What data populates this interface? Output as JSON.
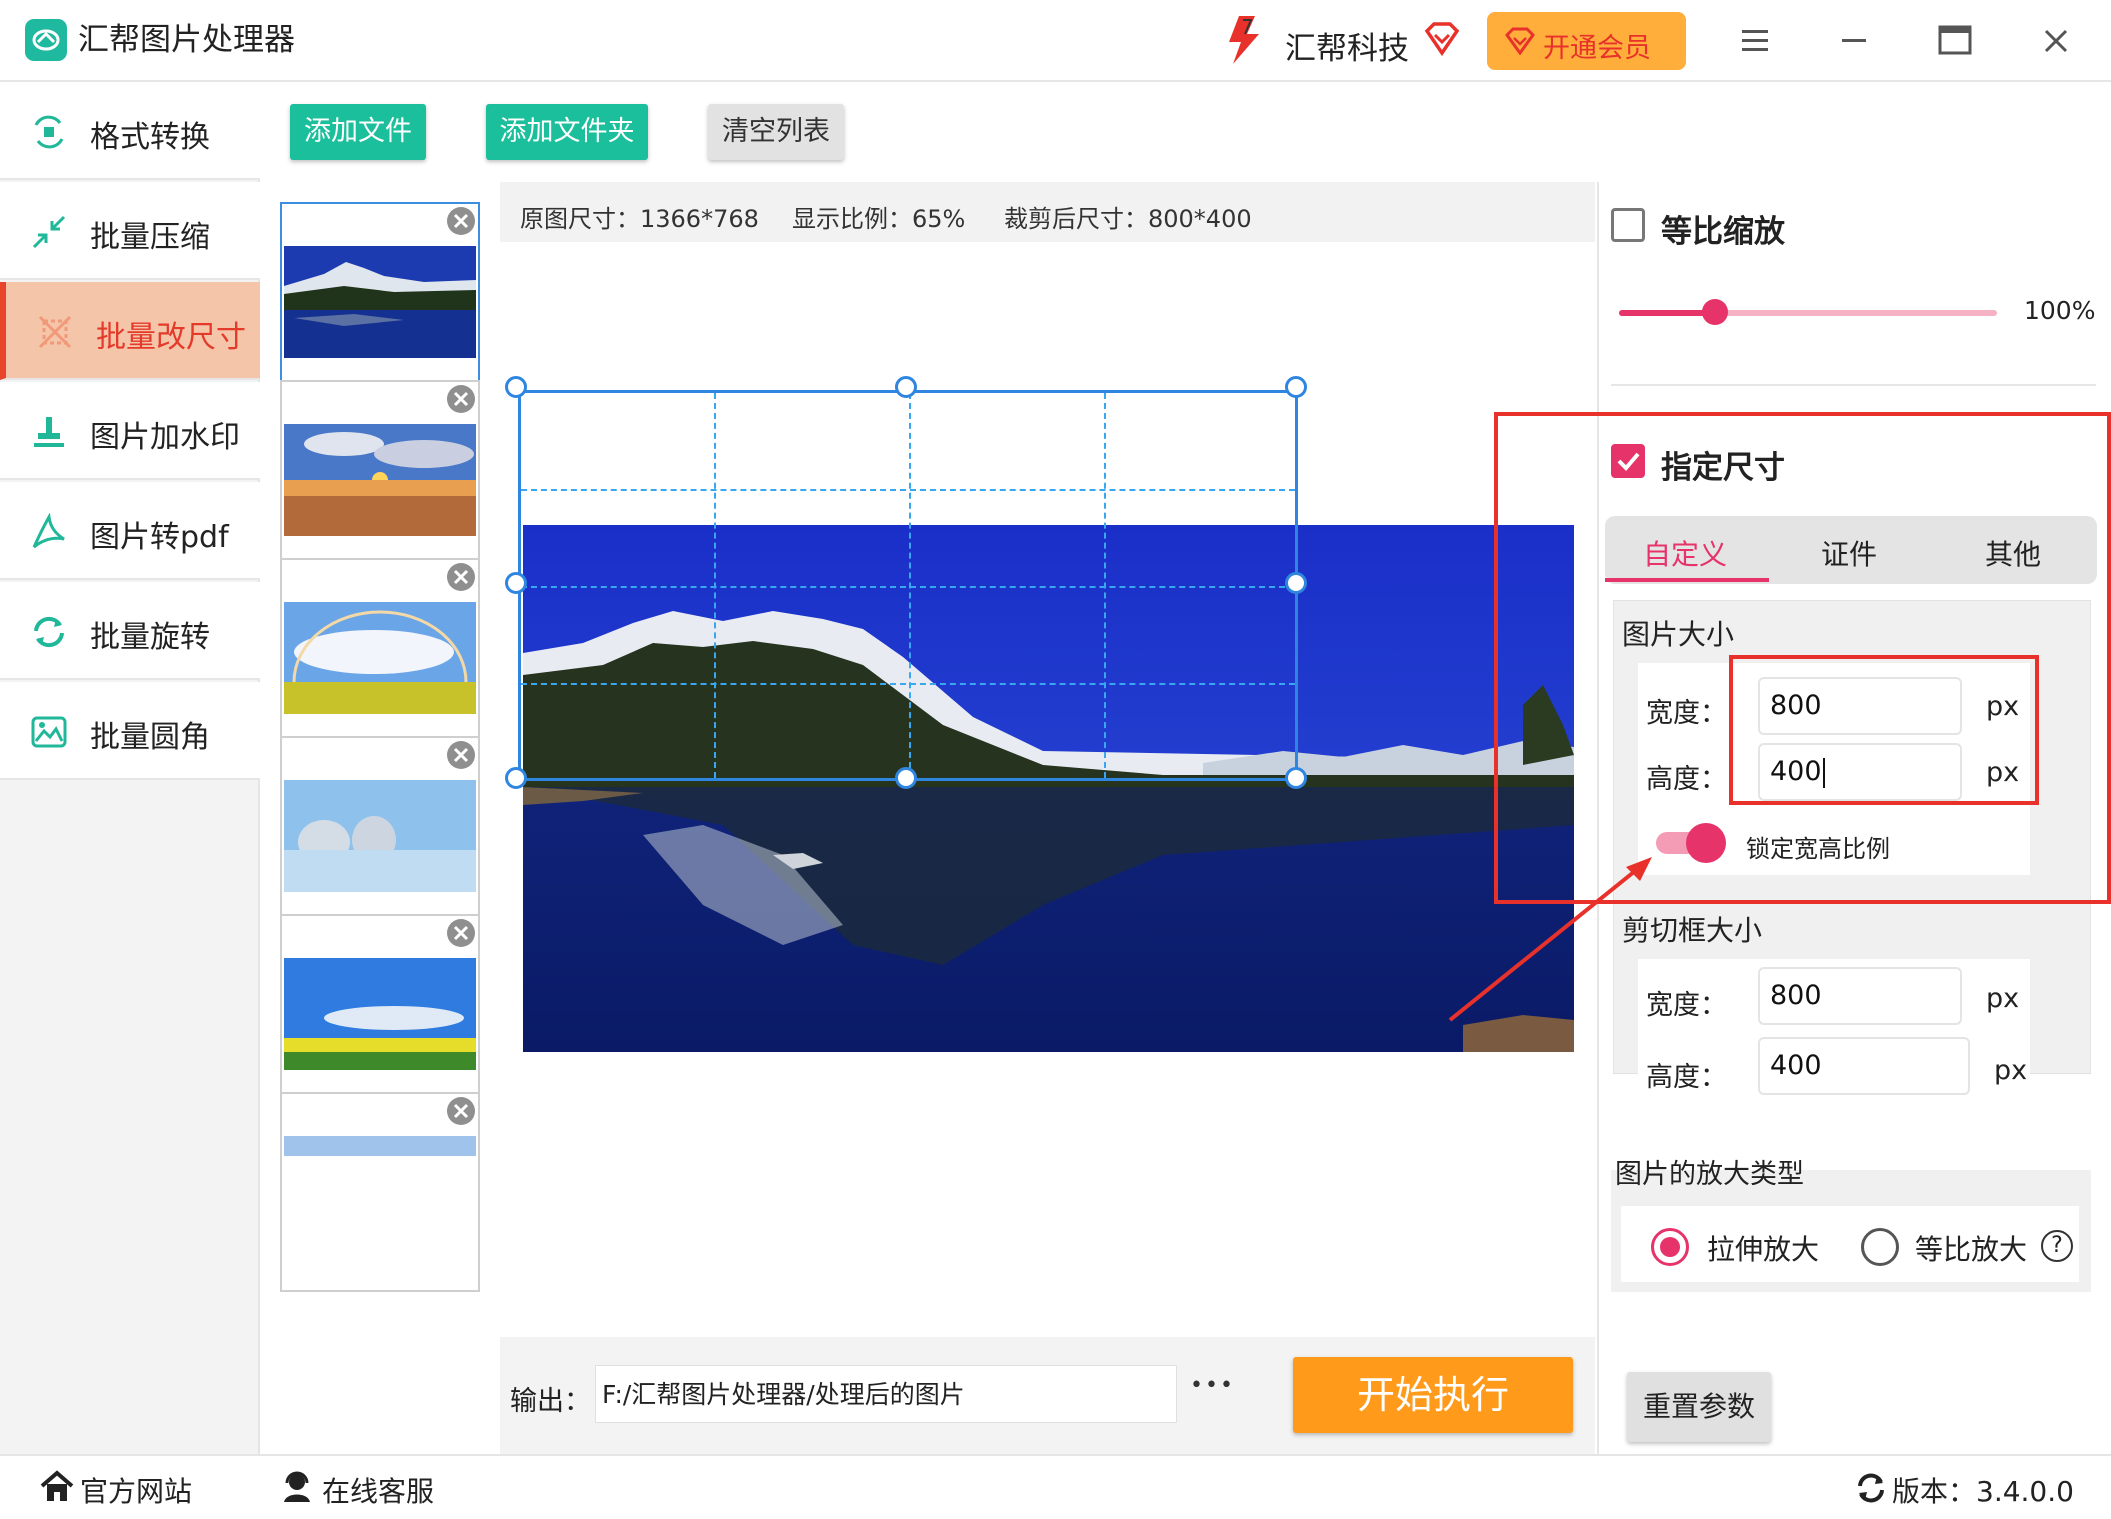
{
  "app": {
    "title": "汇帮图片处理器",
    "brand": "汇帮科技",
    "vip_label": "开通会员"
  },
  "sidebar": {
    "items": [
      {
        "label": "格式转换"
      },
      {
        "label": "批量压缩"
      },
      {
        "label": "批量改尺寸",
        "active": true
      },
      {
        "label": "图片加水印"
      },
      {
        "label": "图片转pdf"
      },
      {
        "label": "批量旋转"
      },
      {
        "label": "批量圆角"
      }
    ]
  },
  "toolbar": {
    "add_file": "添加文件",
    "add_folder": "添加文件夹",
    "clear_list": "清空列表"
  },
  "info": {
    "original_size": "原图尺寸：1366*768",
    "display_ratio": "显示比例：65%",
    "crop_size": "裁剪后尺寸：800*400"
  },
  "output": {
    "label": "输出：",
    "path": "F:/汇帮图片处理器/处理后的图片",
    "more": "•••",
    "start": "开始执行"
  },
  "scale": {
    "label": "等比缩放",
    "checked": false,
    "percent": 100,
    "value_text": "100%"
  },
  "size": {
    "label": "指定尺寸",
    "checked": true,
    "tabs": [
      {
        "label": "自定义",
        "active": true
      },
      {
        "label": "证件"
      },
      {
        "label": "其他"
      }
    ],
    "image_size_title": "图片大小",
    "width_label": "宽度：",
    "height_label": "高度：",
    "width": "800",
    "height": "400",
    "unit": "px",
    "lock_label": "锁定宽高比例",
    "lock_on": true,
    "crop_title": "剪切框大小",
    "crop_width": "800",
    "crop_height": "400"
  },
  "enlarge": {
    "title": "图片的放大类型",
    "options": [
      {
        "label": "拉伸放大",
        "selected": true
      },
      {
        "label": "等比放大"
      }
    ],
    "help": "?"
  },
  "reset": "重置参数",
  "status": {
    "website": "官方网站",
    "support": "在线客服",
    "version": "版本：3.4.0.0"
  },
  "colors": {
    "accent": "#e6336a",
    "green": "#1bbf9b",
    "orange": "#ff9a1a",
    "highlight": "#e8312a"
  }
}
